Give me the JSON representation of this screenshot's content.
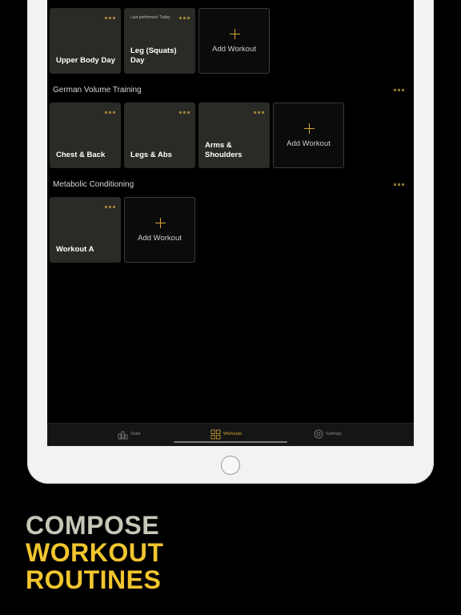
{
  "groups": [
    {
      "title": "",
      "cards": [
        {
          "title": "Upper Body Day",
          "meta": ""
        },
        {
          "title": "Leg (Squats) Day",
          "meta": "Last performed: Today"
        }
      ],
      "add_label": "Add Workout"
    },
    {
      "title": "German Volume Training",
      "cards": [
        {
          "title": "Chest & Back"
        },
        {
          "title": "Legs & Abs"
        },
        {
          "title": "Arms & Shoulders"
        }
      ],
      "add_label": "Add Workout"
    },
    {
      "title": "Metabolic Conditioning",
      "cards": [
        {
          "title": "Workout A"
        }
      ],
      "add_label": "Add Workout"
    }
  ],
  "tabs": [
    {
      "label": "Stats",
      "icon": "stats-icon",
      "active": false
    },
    {
      "label": "Workouts",
      "icon": "workouts-grid-icon",
      "active": true
    },
    {
      "label": "Settings",
      "icon": "settings-gear-icon",
      "active": false
    }
  ],
  "promo": {
    "line1": "COMPOSE",
    "line2": "WORKOUT",
    "line3": "ROUTINES"
  },
  "colors": {
    "accent": "#d6a630",
    "card_bg": "#2a2a26",
    "promo_gray": "#c5c7b8",
    "promo_yellow": "#f1c52e"
  }
}
